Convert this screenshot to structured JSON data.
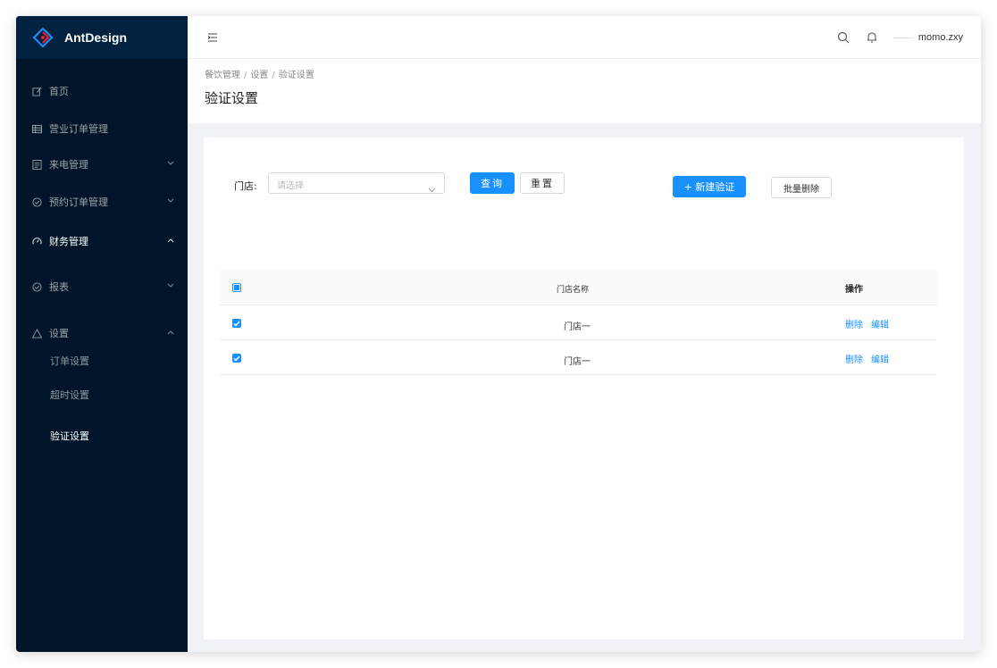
{
  "app": {
    "name": "AntDesign"
  },
  "sidebar": {
    "items": [
      {
        "label": "首页",
        "icon": "edit-icon"
      },
      {
        "label": "营业订单管理",
        "icon": "table-icon"
      },
      {
        "label": "来电管理",
        "icon": "profile-icon"
      },
      {
        "label": "预约订单管理",
        "icon": "check-circle-icon"
      },
      {
        "label": "财务管理",
        "icon": "dashboard-icon"
      },
      {
        "label": "报表",
        "icon": "check-circle-icon"
      },
      {
        "label": "设置",
        "icon": "warning-icon"
      }
    ],
    "sub_items": [
      {
        "label": "订单设置"
      },
      {
        "label": "超时设置"
      },
      {
        "label": "验证设置"
      }
    ]
  },
  "header": {
    "username": "momo.zxy"
  },
  "breadcrumb": {
    "items": [
      "餐饮管理",
      "设置",
      "验证设置"
    ],
    "separator": "/"
  },
  "page": {
    "title": "验证设置"
  },
  "filter": {
    "store_label": "门店:",
    "store_placeholder": "请选择",
    "query_label": "查询",
    "reset_label": "重置",
    "new_label": "+ 新建验证",
    "batch_delete_label": "批量删除"
  },
  "table": {
    "columns": [
      "门店名称",
      "操作"
    ],
    "rows": [
      {
        "name": "门店一",
        "checked": true,
        "actions": [
          "删除",
          "编辑"
        ]
      },
      {
        "name": "门店一",
        "checked": true,
        "actions": [
          "删除",
          "编辑"
        ]
      }
    ]
  },
  "colors": {
    "sider": "#001529",
    "primary": "#1890ff",
    "background": "#f0f2f5"
  }
}
